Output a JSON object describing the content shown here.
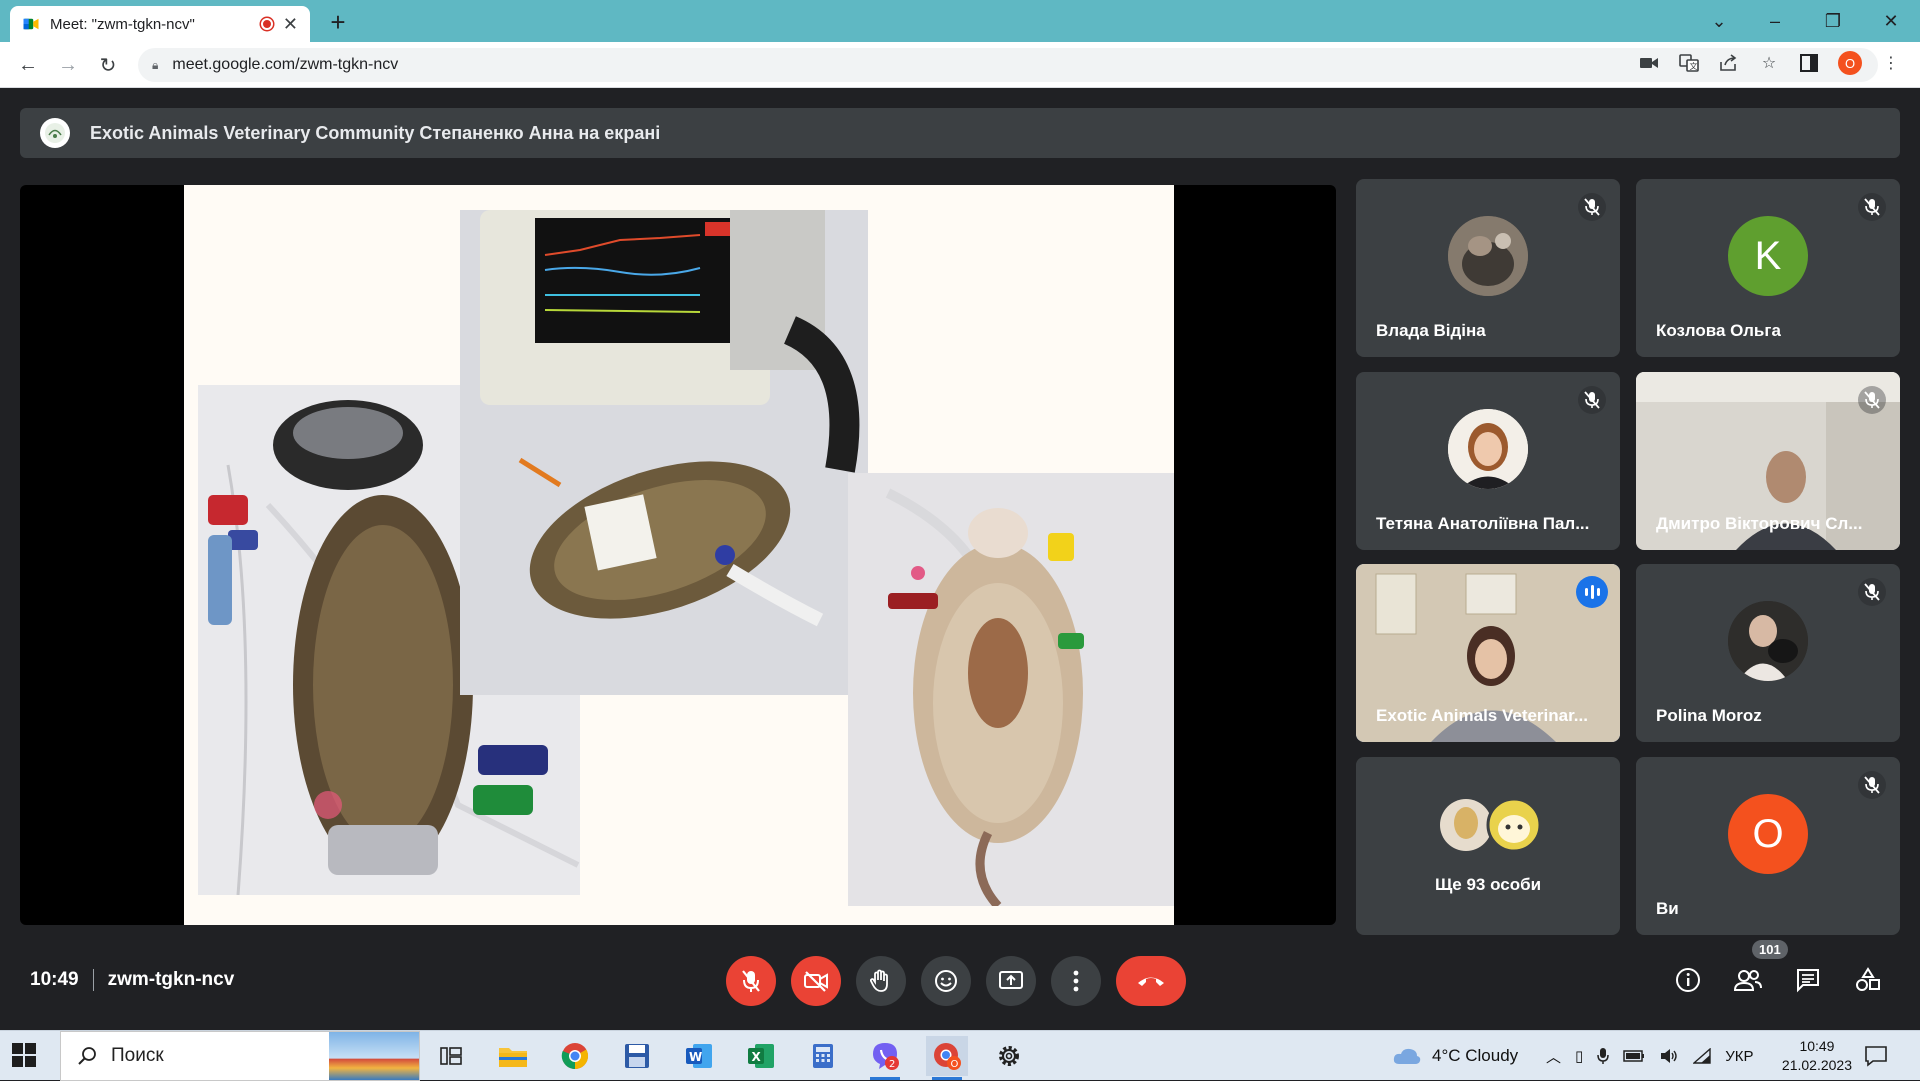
{
  "browser": {
    "tab_title": "Meet: \"zwm-tgkn-ncv\"",
    "url": "meet.google.com/zwm-tgkn-ncv",
    "profile_initial": "O"
  },
  "meet": {
    "presenting_label": "Exotic Animals Veterinary Community Степаненко Анна на екрані",
    "time": "10:49",
    "meeting_code": "zwm-tgkn-ncv",
    "participants_count": "101",
    "tiles": [
      {
        "name": "Влада Відіна",
        "muted": true
      },
      {
        "name": "Козлова Ольга",
        "initial": "K",
        "muted": true
      },
      {
        "name": "Тетяна Анатоліївна Пал...",
        "muted": true
      },
      {
        "name": "Дмитро Вікторович Сл...",
        "muted": true
      },
      {
        "name": "Exotic Animals Veterinar...",
        "speaking": true
      },
      {
        "name": "Polina Moroz",
        "muted": true
      },
      {
        "name": "Ще 93 особи"
      },
      {
        "name": "Ви",
        "initial": "O",
        "muted": true
      }
    ]
  },
  "taskbar": {
    "search_placeholder": "Поиск",
    "weather": "4°C  Cloudy",
    "language": "УКР",
    "time": "10:49",
    "date": "21.02.2023",
    "viber_badge": "2",
    "chrome_badge": "O"
  },
  "colors": {
    "tab_strip": "#5fb8c3",
    "meet_bg": "#202124",
    "tile_bg": "#3c4043",
    "danger": "#ea4335",
    "active_border": "#8ab4f8",
    "green_avatar": "#5f9f2f",
    "orange_avatar": "#f4511e"
  }
}
